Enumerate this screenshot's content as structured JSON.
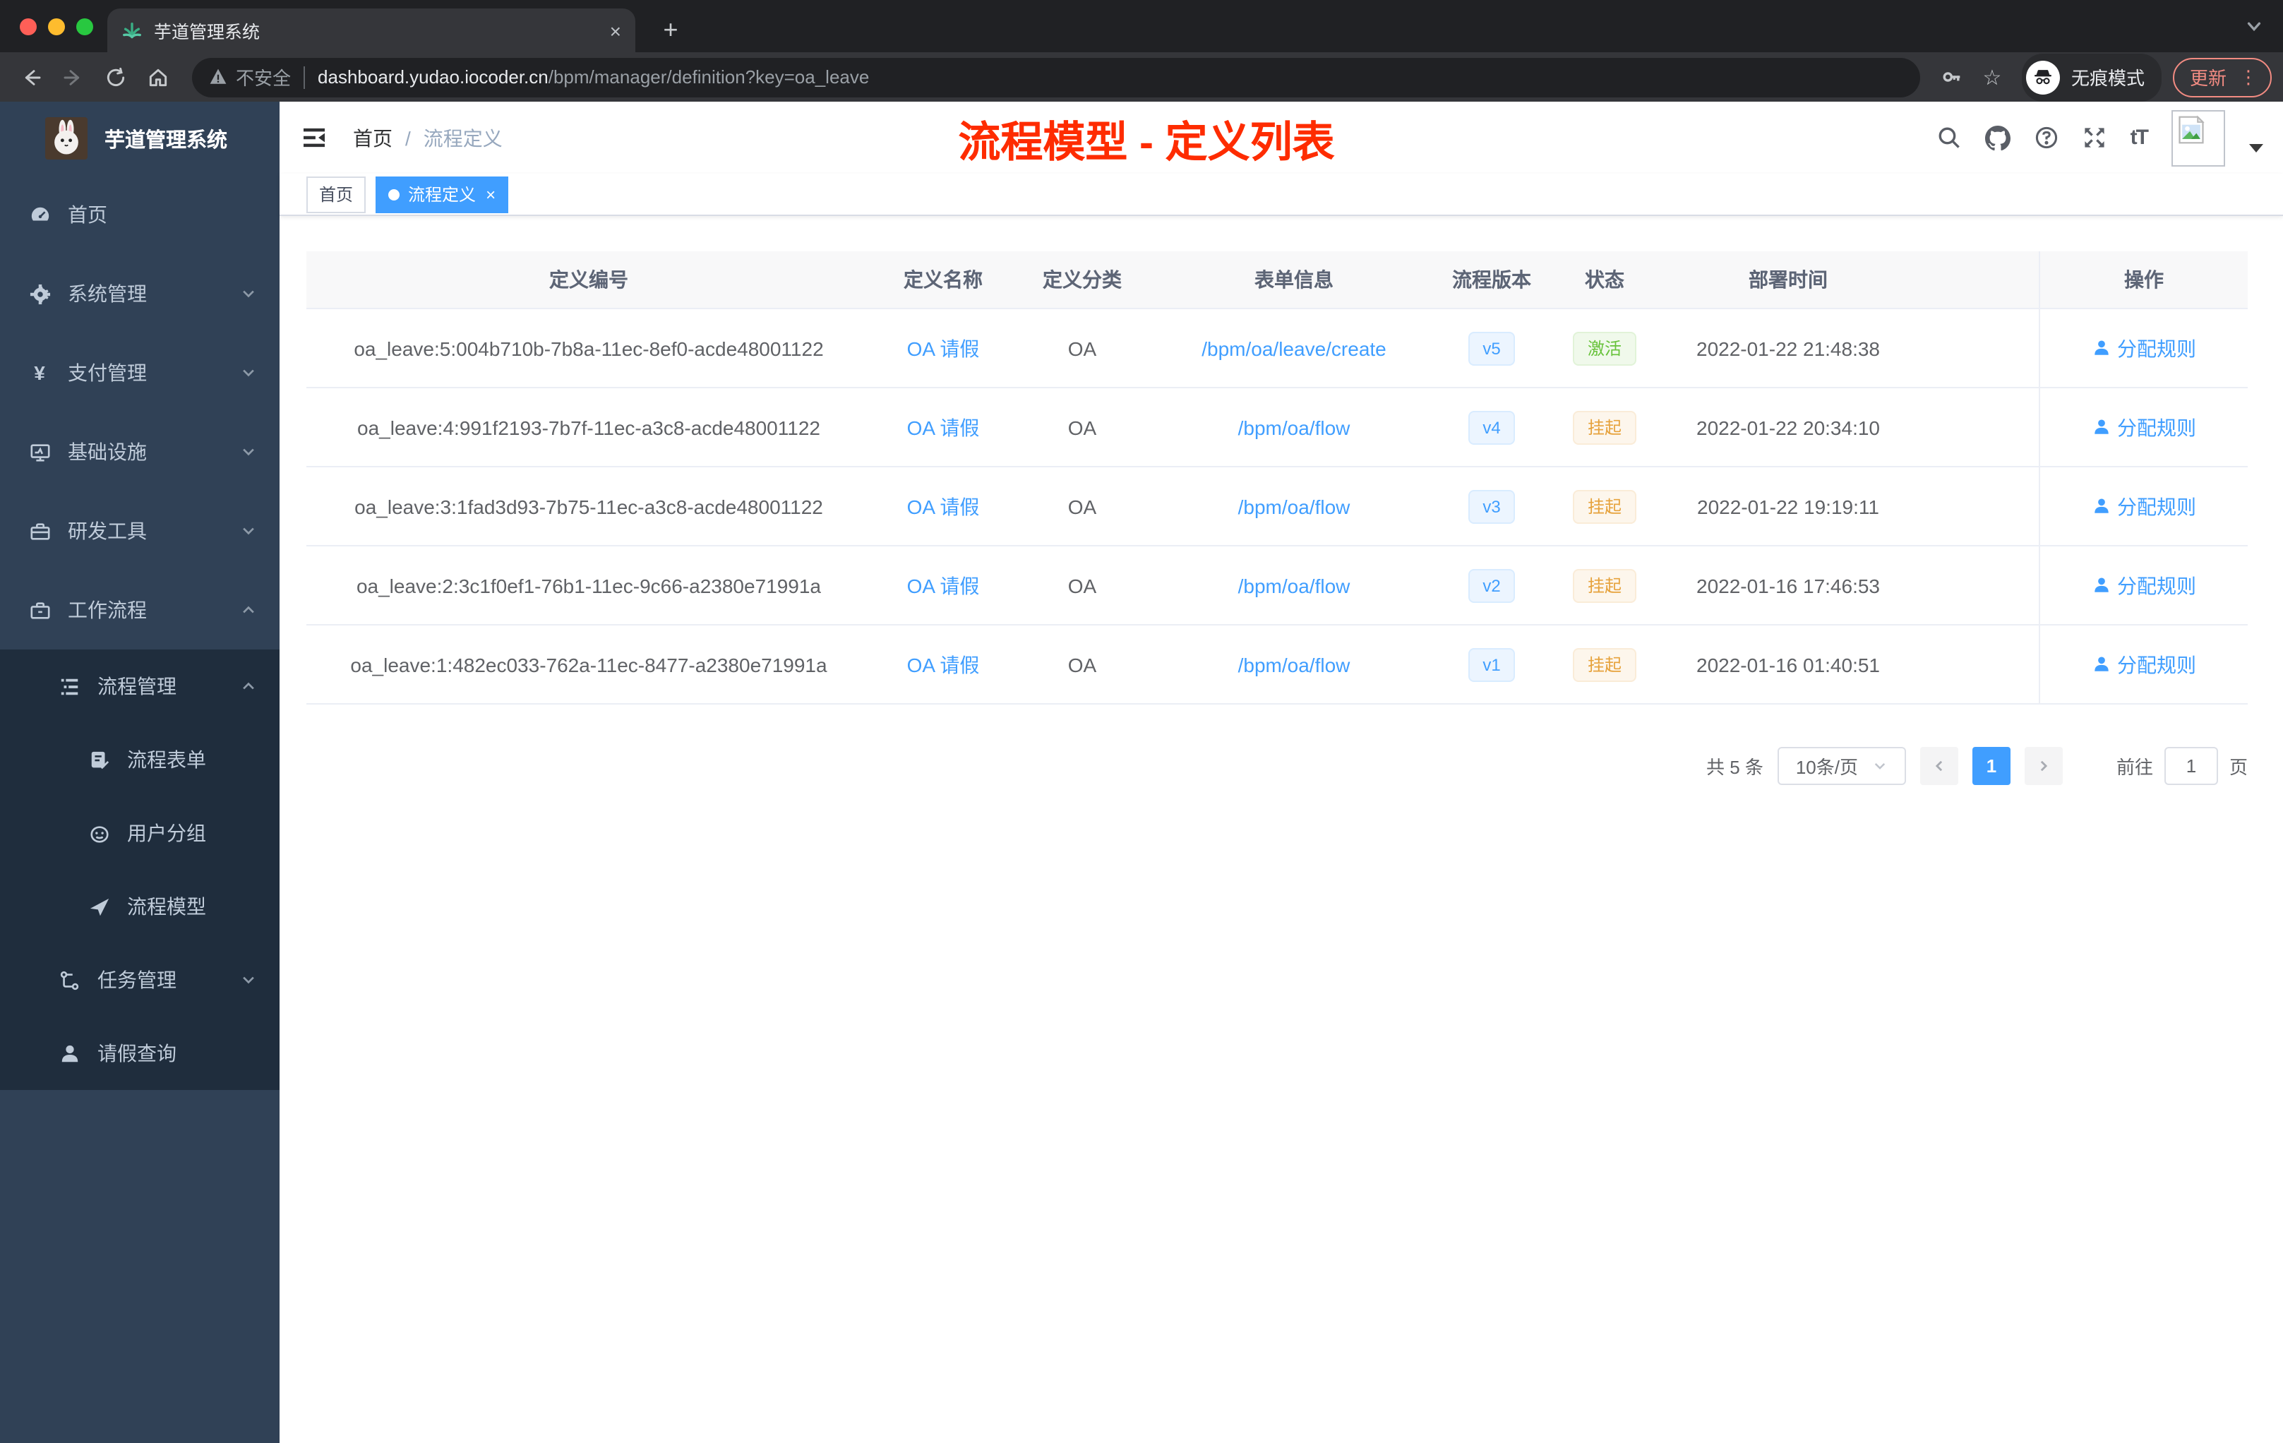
{
  "browser": {
    "tab": {
      "title": "芋道管理系统"
    },
    "toolbar": {
      "security_label": "不安全",
      "url_host": "dashboard.yudao.iocoder.cn",
      "url_path": "/bpm/manager/definition?key=oa_leave",
      "incognito_label": "无痕模式",
      "update_label": "更新"
    }
  },
  "icons": {
    "close": "×",
    "plus": "+",
    "star": "☆",
    "more": "⋮",
    "slash": "/",
    "text_size": "tT"
  },
  "sidebar": {
    "title": "芋道管理系统",
    "items": [
      {
        "label": "首页"
      },
      {
        "label": "系统管理"
      },
      {
        "label": "支付管理"
      },
      {
        "label": "基础设施"
      },
      {
        "label": "研发工具"
      },
      {
        "label": "工作流程"
      },
      {
        "label": "流程管理"
      },
      {
        "label": "流程表单"
      },
      {
        "label": "用户分组"
      },
      {
        "label": "流程模型"
      },
      {
        "label": "任务管理"
      },
      {
        "label": "请假查询"
      }
    ]
  },
  "header": {
    "breadcrumb": {
      "home": "首页",
      "current": "流程定义"
    },
    "annotation": "流程模型 - 定义列表"
  },
  "tags": {
    "home": "首页",
    "active": "流程定义"
  },
  "table": {
    "columns": [
      "定义编号",
      "定义名称",
      "定义分类",
      "表单信息",
      "流程版本",
      "状态",
      "部署时间",
      "操作"
    ],
    "rows": [
      {
        "id": "oa_leave:5:004b710b-7b8a-11ec-8ef0-acde48001122",
        "name": "OA 请假",
        "category": "OA",
        "form": "/bpm/oa/leave/create",
        "version": "v5",
        "status": "激活",
        "status_type": "success",
        "time": "2022-01-22 21:48:38",
        "action": "分配规则"
      },
      {
        "id": "oa_leave:4:991f2193-7b7f-11ec-a3c8-acde48001122",
        "name": "OA 请假",
        "category": "OA",
        "form": "/bpm/oa/flow",
        "version": "v4",
        "status": "挂起",
        "status_type": "warning",
        "time": "2022-01-22 20:34:10",
        "action": "分配规则"
      },
      {
        "id": "oa_leave:3:1fad3d93-7b75-11ec-a3c8-acde48001122",
        "name": "OA 请假",
        "category": "OA",
        "form": "/bpm/oa/flow",
        "version": "v3",
        "status": "挂起",
        "status_type": "warning",
        "time": "2022-01-22 19:19:11",
        "action": "分配规则"
      },
      {
        "id": "oa_leave:2:3c1f0ef1-76b1-11ec-9c66-a2380e71991a",
        "name": "OA 请假",
        "category": "OA",
        "form": "/bpm/oa/flow",
        "version": "v2",
        "status": "挂起",
        "status_type": "warning",
        "time": "2022-01-16 17:46:53",
        "action": "分配规则"
      },
      {
        "id": "oa_leave:1:482ec033-762a-11ec-8477-a2380e71991a",
        "name": "OA 请假",
        "category": "OA",
        "form": "/bpm/oa/flow",
        "version": "v1",
        "status": "挂起",
        "status_type": "warning",
        "time": "2022-01-16 01:40:51",
        "action": "分配规则"
      }
    ]
  },
  "pagination": {
    "total": "共 5 条",
    "page_size": "10条/页",
    "page": "1",
    "goto_label": "前往",
    "page_input": "1",
    "unit": "页"
  },
  "colors": {
    "accent": "#409eff",
    "annotation_red": "#fe2c00",
    "sidebar_bg": "#304156",
    "submenu_bg": "#1f2d3d",
    "tag_success": "#67c23a",
    "tag_warning": "#e6a23c",
    "update_button": "#f28b82"
  }
}
